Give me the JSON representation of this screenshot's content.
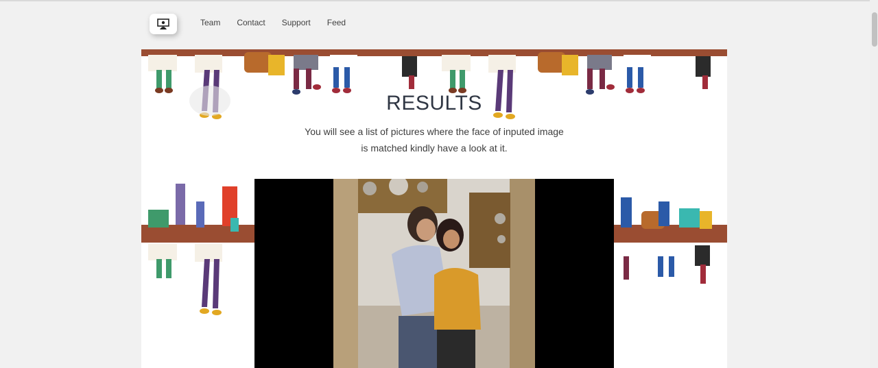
{
  "nav": {
    "logo_icon": "presentation-person-icon",
    "links": [
      "Team",
      "Contact",
      "Support",
      "Feed"
    ]
  },
  "hero": {
    "title": "RESULTS",
    "subtitle_line1": "You will see a list of pictures where the face of inputed image",
    "subtitle_line2": "is matched kindly have a look at it."
  },
  "result": {
    "image_desc_icon": "matched-photo"
  },
  "colors": {
    "page_bg": "#f1f1f1",
    "card_bg": "#ffffff",
    "title": "#2f3643",
    "bench": "#9a4d32"
  }
}
